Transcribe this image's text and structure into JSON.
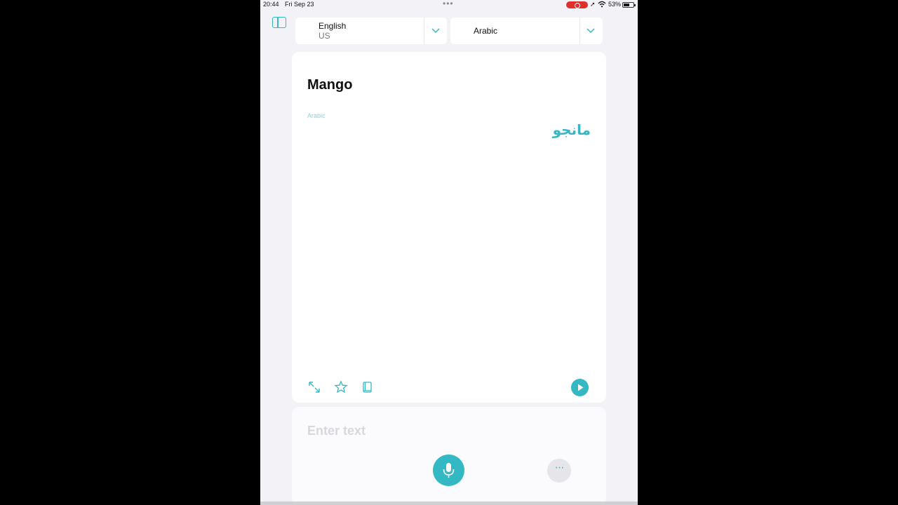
{
  "status_bar": {
    "time": "20:44",
    "date": "Fri Sep 23",
    "battery": "53%",
    "icons": [
      "multitask-dots-icon",
      "screen-record-icon",
      "location-icon",
      "wifi-icon",
      "battery-icon"
    ],
    "record_color": "#e0302e"
  },
  "header": {
    "sidebar_icon": "sidebar-toggle-icon",
    "source_language": {
      "name": "English",
      "region": "US"
    },
    "target_language": {
      "name": "Arabic"
    }
  },
  "translation_card": {
    "source_text": "Mango",
    "target_language_label": "Arabic",
    "translated_text": "مانجو",
    "actions": [
      "expand-icon",
      "favorite-star-icon",
      "dictionary-book-icon",
      "play-icon"
    ]
  },
  "input": {
    "placeholder": "Enter text",
    "mic_icon": "microphone-icon",
    "more_icon": "more-dots-icon",
    "more_label": "···"
  },
  "colors": {
    "accent": "#34b8c4",
    "background": "#f2f2f7",
    "card": "#ffffff"
  }
}
